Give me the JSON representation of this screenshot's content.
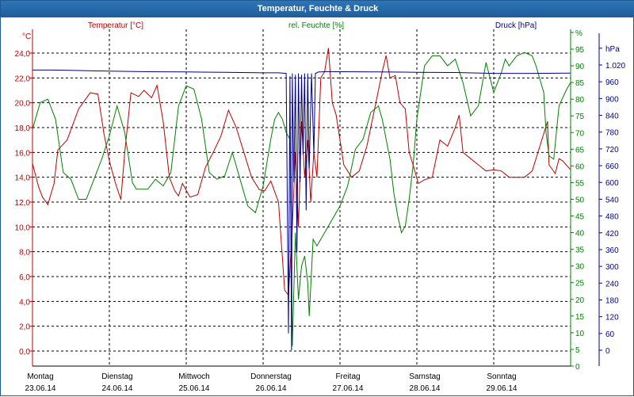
{
  "window": {
    "title": "Temperatur, Feuchte & Druck"
  },
  "colors": {
    "temperature": "#c00000",
    "humidity": "#008000",
    "pressure": "#00008b",
    "titlebar": "#1f5d9b",
    "grid": "#000000"
  },
  "chart_data": {
    "type": "line",
    "title": "Temperatur, Feuchte & Druck",
    "grid": true,
    "x_range_days": [
      0,
      7
    ],
    "x_ticks": [
      {
        "day": "Montag",
        "date": "23.06.14"
      },
      {
        "day": "Dienstag",
        "date": "24.06.14"
      },
      {
        "day": "Mittwoch",
        "date": "25.06.14"
      },
      {
        "day": "Donnerstag",
        "date": "26.06.14"
      },
      {
        "day": "Freitag",
        "date": "27.06.14"
      },
      {
        "day": "Samstag",
        "date": "28.06.14"
      },
      {
        "day": "Sonntag",
        "date": "29.06.14"
      }
    ],
    "axes": {
      "temperature": {
        "unit": "°C",
        "label": "Temperatur [°C]",
        "range": [
          -1.2,
          25.3
        ],
        "ticks": [
          "0,0",
          "2,0",
          "4,0",
          "6,0",
          "8,0",
          "10,0",
          "12,0",
          "14,0",
          "16,0",
          "18,0",
          "20,0",
          "22,0",
          "24,0"
        ]
      },
      "humidity": {
        "unit": "%",
        "label": "rel. Feuchte [%]",
        "range": [
          0,
          100
        ],
        "ticks": [
          "0",
          "5",
          "10",
          "15",
          "20",
          "25",
          "30",
          "35",
          "40",
          "45",
          "50",
          "55",
          "60",
          "65",
          "70",
          "75",
          "80",
          "85",
          "90",
          "95",
          "%"
        ]
      },
      "pressure": {
        "unit": "hPa",
        "label": "Druck [hPa]",
        "range": [
          -60,
          1080
        ],
        "ticks": [
          "0",
          "60",
          "120",
          "180",
          "240",
          "300",
          "360",
          "420",
          "480",
          "540",
          "600",
          "660",
          "720",
          "780",
          "840",
          "900",
          "960",
          "1.020",
          "hPa"
        ]
      }
    },
    "series": [
      {
        "name": "Temperatur [°C]",
        "axis": "temperature",
        "x": [
          0,
          0.08,
          0.13,
          0.2,
          0.28,
          0.33,
          0.45,
          0.6,
          0.75,
          0.85,
          0.93,
          1.0,
          1.08,
          1.15,
          1.2,
          1.28,
          1.38,
          1.45,
          1.55,
          1.62,
          1.7,
          1.78,
          1.85,
          1.9,
          1.95,
          2.05,
          2.15,
          2.25,
          2.35,
          2.45,
          2.55,
          2.65,
          2.75,
          2.85,
          2.95,
          3.02,
          3.1,
          3.2,
          3.28,
          3.33,
          3.38,
          3.42,
          3.46,
          3.5,
          3.54,
          3.58,
          3.62,
          3.66,
          3.7,
          3.75,
          3.8,
          3.85,
          3.9,
          3.95,
          4.05,
          4.15,
          4.25,
          4.35,
          4.45,
          4.55,
          4.6,
          4.65,
          4.72,
          4.78,
          4.85,
          4.9,
          4.95,
          5.02,
          5.1,
          5.2,
          5.3,
          5.4,
          5.5,
          5.55,
          5.6,
          5.7,
          5.8,
          5.9,
          6.0,
          6.1,
          6.2,
          6.3,
          6.4,
          6.5,
          6.6,
          6.7,
          6.72,
          6.8,
          6.85,
          6.9,
          7.0
        ],
        "y": [
          15.1,
          13.2,
          12.4,
          11.8,
          13.5,
          16.2,
          17.0,
          19.5,
          20.8,
          20.7,
          17.5,
          15.3,
          13.5,
          12.2,
          16.0,
          20.8,
          20.5,
          21.0,
          20.4,
          21.4,
          18.5,
          14.0,
          12.9,
          12.5,
          13.5,
          12.4,
          12.6,
          14.8,
          16.0,
          17.3,
          19.4,
          18.0,
          16.0,
          14.0,
          13.0,
          12.9,
          13.7,
          12.0,
          4.9,
          4.5,
          10.0,
          16.0,
          10.0,
          18.5,
          14.0,
          17.0,
          12.0,
          16.0,
          14.0,
          22.0,
          22.5,
          24.4,
          20.0,
          19.0,
          15.0,
          14.0,
          14.5,
          16.5,
          19.5,
          22.5,
          23.8,
          22.0,
          22.2,
          20.0,
          19.5,
          16.0,
          15.0,
          13.5,
          13.8,
          14.0,
          17.0,
          16.5,
          18.0,
          19.0,
          16.0,
          15.5,
          15.0,
          14.5,
          14.6,
          14.5,
          14.0,
          14.0,
          14.0,
          14.5,
          16.5,
          18.5,
          15.0,
          14.3,
          15.5,
          15.3,
          14.6
        ]
      },
      {
        "name": "rel. Feuchte [%]",
        "axis": "humidity",
        "x": [
          0,
          0.1,
          0.2,
          0.3,
          0.4,
          0.5,
          0.6,
          0.7,
          0.8,
          0.9,
          1.0,
          1.1,
          1.2,
          1.3,
          1.35,
          1.4,
          1.5,
          1.6,
          1.7,
          1.8,
          1.9,
          2.0,
          2.1,
          2.2,
          2.3,
          2.4,
          2.5,
          2.6,
          2.7,
          2.8,
          2.9,
          3.0,
          3.1,
          3.15,
          3.2,
          3.25,
          3.3,
          3.35,
          3.38,
          3.42,
          3.46,
          3.5,
          3.54,
          3.58,
          3.6,
          3.65,
          3.7,
          3.8,
          3.9,
          4.0,
          4.1,
          4.2,
          4.3,
          4.4,
          4.5,
          4.55,
          4.6,
          4.65,
          4.7,
          4.75,
          4.8,
          4.85,
          4.9,
          4.95,
          5.0,
          5.1,
          5.2,
          5.3,
          5.4,
          5.5,
          5.6,
          5.7,
          5.8,
          5.9,
          6.0,
          6.1,
          6.15,
          6.2,
          6.3,
          6.4,
          6.5,
          6.55,
          6.6,
          6.65,
          6.68,
          6.72,
          6.78,
          6.85,
          6.95,
          7.0
        ],
        "y": [
          71,
          79,
          80,
          74,
          58,
          56,
          50,
          50,
          56,
          62,
          69,
          78,
          70,
          55,
          53,
          53,
          53,
          56,
          54,
          58,
          78,
          84,
          83,
          74,
          58,
          56,
          57,
          64,
          56,
          48,
          46,
          54,
          68,
          74,
          76,
          74,
          70,
          68,
          6,
          40,
          20,
          30,
          33,
          25,
          15,
          38,
          36,
          40,
          44,
          48,
          54,
          65,
          68,
          76,
          78,
          74,
          68,
          62,
          52,
          45,
          40,
          42,
          50,
          60,
          74,
          90,
          93,
          93,
          90,
          92,
          85,
          75,
          78,
          91,
          82,
          88,
          92,
          90,
          93,
          94,
          93,
          90,
          86,
          82,
          70,
          63,
          62,
          78,
          83,
          85
        ]
      },
      {
        "name": "Druck [hPa]",
        "axis": "pressure",
        "x": [
          0,
          0.25,
          0.5,
          1.0,
          1.5,
          2.0,
          2.5,
          3.0,
          3.2,
          3.3,
          3.33,
          3.35,
          3.37,
          3.38,
          3.4,
          3.42,
          3.44,
          3.46,
          3.48,
          3.5,
          3.52,
          3.54,
          3.56,
          3.58,
          3.6,
          3.63,
          3.66,
          3.68,
          3.7,
          3.72,
          3.75,
          3.8,
          3.9,
          4.0,
          4.5,
          5.0,
          5.5,
          6.0,
          6.5,
          7.0
        ],
        "y": [
          1002,
          1002,
          1001,
          998,
          996,
          995,
          994,
          992,
          992,
          990,
          60,
          980,
          0,
          990,
          600,
          985,
          350,
          990,
          600,
          985,
          700,
          990,
          500,
          990,
          650,
          990,
          700,
          990,
          992,
          995,
          995,
          996,
          996,
          996,
          995,
          994,
          993,
          990,
          990,
          991
        ]
      }
    ]
  }
}
